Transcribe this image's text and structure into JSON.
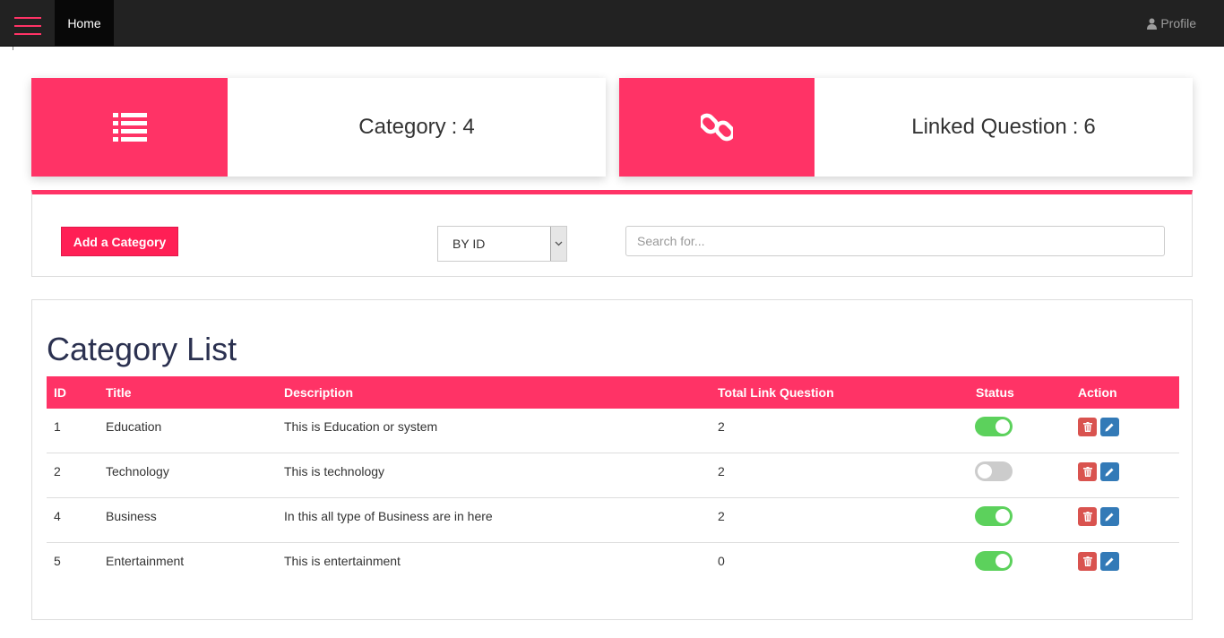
{
  "navbar": {
    "home_label": "Home",
    "profile_label": "Profile"
  },
  "stats": [
    {
      "label": "Category",
      "separator": ":",
      "value": "4",
      "icon": "list-icon"
    },
    {
      "label": "Linked Question",
      "separator": ":",
      "value": "6",
      "icon": "link-icon"
    }
  ],
  "filter": {
    "add_button_label": "Add a Category",
    "sort_selected": "BY ID",
    "search_placeholder": "Search for..."
  },
  "category_list": {
    "title": "Category List",
    "columns": [
      "ID",
      "Title",
      "Description",
      "Total Link Question",
      "Status",
      "Action"
    ],
    "rows": [
      {
        "id": "1",
        "title": "Education",
        "description": "This is Education or system",
        "total": "2",
        "status": "on"
      },
      {
        "id": "2",
        "title": "Technology",
        "description": "This is technology",
        "total": "2",
        "status": "off"
      },
      {
        "id": "4",
        "title": "Business",
        "description": "In this all type of Business are in here",
        "total": "2",
        "status": "on"
      },
      {
        "id": "5",
        "title": "Entertainment",
        "description": "This is entertainment",
        "total": "0",
        "status": "on"
      }
    ]
  },
  "colors": {
    "accent": "#ff3366",
    "navbar": "#222222",
    "toggle_on": "#5cd15c",
    "toggle_off": "#cccccc",
    "delete": "#d9534f",
    "edit": "#337ab7",
    "title_text": "#2b3150"
  }
}
